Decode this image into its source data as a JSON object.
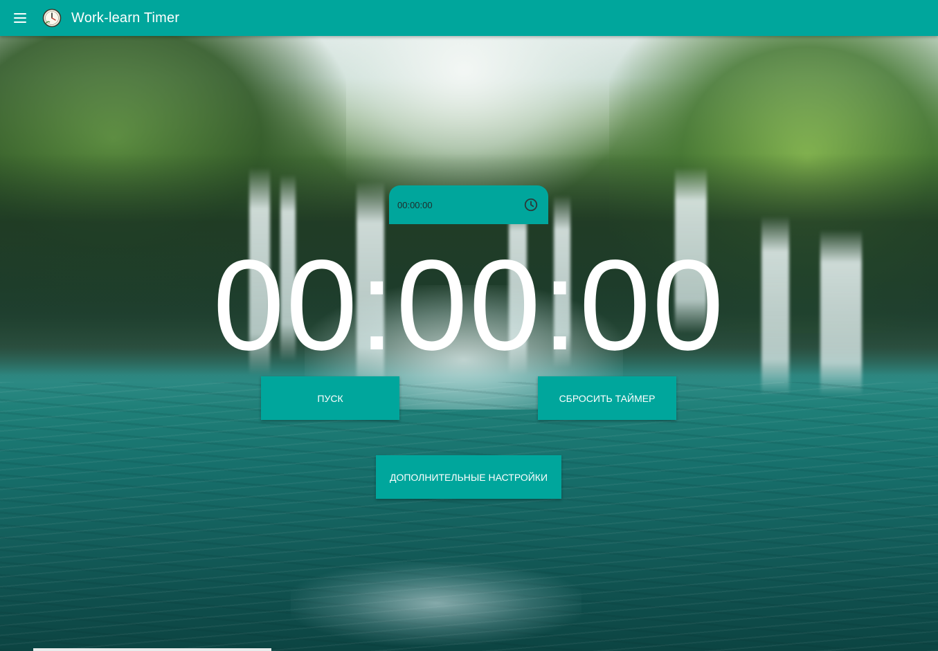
{
  "app": {
    "title": "Work-learn Timer",
    "accent_color": "#00a69c"
  },
  "icons": {
    "menu": "menu-icon",
    "logo": "clock-logo-icon",
    "time_picker": "clock-icon"
  },
  "time_input": {
    "value": "00:00:00"
  },
  "timer": {
    "display": "00:00:00"
  },
  "buttons": {
    "start": "ПУСК",
    "reset": "СБРОСИТЬ ТАЙМЕР",
    "settings": "ДОПОЛНИТЕЛЬНЫЕ НАСТРОЙКИ"
  }
}
